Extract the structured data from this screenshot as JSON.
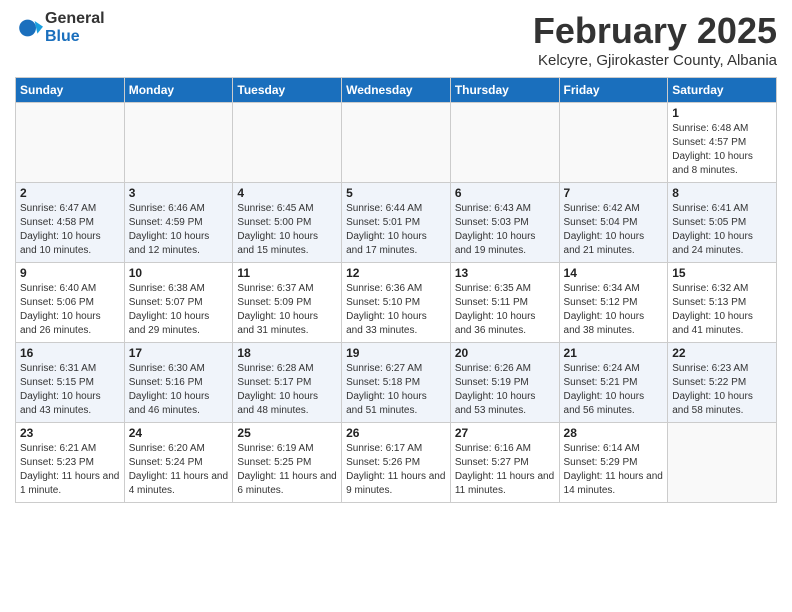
{
  "logo": {
    "general": "General",
    "blue": "Blue"
  },
  "title": "February 2025",
  "subtitle": "Kelcyre, Gjirokaster County, Albania",
  "days_header": [
    "Sunday",
    "Monday",
    "Tuesday",
    "Wednesday",
    "Thursday",
    "Friday",
    "Saturday"
  ],
  "weeks": [
    [
      {
        "day": "",
        "info": ""
      },
      {
        "day": "",
        "info": ""
      },
      {
        "day": "",
        "info": ""
      },
      {
        "day": "",
        "info": ""
      },
      {
        "day": "",
        "info": ""
      },
      {
        "day": "",
        "info": ""
      },
      {
        "day": "1",
        "info": "Sunrise: 6:48 AM\nSunset: 4:57 PM\nDaylight: 10 hours and 8 minutes."
      }
    ],
    [
      {
        "day": "2",
        "info": "Sunrise: 6:47 AM\nSunset: 4:58 PM\nDaylight: 10 hours and 10 minutes."
      },
      {
        "day": "3",
        "info": "Sunrise: 6:46 AM\nSunset: 4:59 PM\nDaylight: 10 hours and 12 minutes."
      },
      {
        "day": "4",
        "info": "Sunrise: 6:45 AM\nSunset: 5:00 PM\nDaylight: 10 hours and 15 minutes."
      },
      {
        "day": "5",
        "info": "Sunrise: 6:44 AM\nSunset: 5:01 PM\nDaylight: 10 hours and 17 minutes."
      },
      {
        "day": "6",
        "info": "Sunrise: 6:43 AM\nSunset: 5:03 PM\nDaylight: 10 hours and 19 minutes."
      },
      {
        "day": "7",
        "info": "Sunrise: 6:42 AM\nSunset: 5:04 PM\nDaylight: 10 hours and 21 minutes."
      },
      {
        "day": "8",
        "info": "Sunrise: 6:41 AM\nSunset: 5:05 PM\nDaylight: 10 hours and 24 minutes."
      }
    ],
    [
      {
        "day": "9",
        "info": "Sunrise: 6:40 AM\nSunset: 5:06 PM\nDaylight: 10 hours and 26 minutes."
      },
      {
        "day": "10",
        "info": "Sunrise: 6:38 AM\nSunset: 5:07 PM\nDaylight: 10 hours and 29 minutes."
      },
      {
        "day": "11",
        "info": "Sunrise: 6:37 AM\nSunset: 5:09 PM\nDaylight: 10 hours and 31 minutes."
      },
      {
        "day": "12",
        "info": "Sunrise: 6:36 AM\nSunset: 5:10 PM\nDaylight: 10 hours and 33 minutes."
      },
      {
        "day": "13",
        "info": "Sunrise: 6:35 AM\nSunset: 5:11 PM\nDaylight: 10 hours and 36 minutes."
      },
      {
        "day": "14",
        "info": "Sunrise: 6:34 AM\nSunset: 5:12 PM\nDaylight: 10 hours and 38 minutes."
      },
      {
        "day": "15",
        "info": "Sunrise: 6:32 AM\nSunset: 5:13 PM\nDaylight: 10 hours and 41 minutes."
      }
    ],
    [
      {
        "day": "16",
        "info": "Sunrise: 6:31 AM\nSunset: 5:15 PM\nDaylight: 10 hours and 43 minutes."
      },
      {
        "day": "17",
        "info": "Sunrise: 6:30 AM\nSunset: 5:16 PM\nDaylight: 10 hours and 46 minutes."
      },
      {
        "day": "18",
        "info": "Sunrise: 6:28 AM\nSunset: 5:17 PM\nDaylight: 10 hours and 48 minutes."
      },
      {
        "day": "19",
        "info": "Sunrise: 6:27 AM\nSunset: 5:18 PM\nDaylight: 10 hours and 51 minutes."
      },
      {
        "day": "20",
        "info": "Sunrise: 6:26 AM\nSunset: 5:19 PM\nDaylight: 10 hours and 53 minutes."
      },
      {
        "day": "21",
        "info": "Sunrise: 6:24 AM\nSunset: 5:21 PM\nDaylight: 10 hours and 56 minutes."
      },
      {
        "day": "22",
        "info": "Sunrise: 6:23 AM\nSunset: 5:22 PM\nDaylight: 10 hours and 58 minutes."
      }
    ],
    [
      {
        "day": "23",
        "info": "Sunrise: 6:21 AM\nSunset: 5:23 PM\nDaylight: 11 hours and 1 minute."
      },
      {
        "day": "24",
        "info": "Sunrise: 6:20 AM\nSunset: 5:24 PM\nDaylight: 11 hours and 4 minutes."
      },
      {
        "day": "25",
        "info": "Sunrise: 6:19 AM\nSunset: 5:25 PM\nDaylight: 11 hours and 6 minutes."
      },
      {
        "day": "26",
        "info": "Sunrise: 6:17 AM\nSunset: 5:26 PM\nDaylight: 11 hours and 9 minutes."
      },
      {
        "day": "27",
        "info": "Sunrise: 6:16 AM\nSunset: 5:27 PM\nDaylight: 11 hours and 11 minutes."
      },
      {
        "day": "28",
        "info": "Sunrise: 6:14 AM\nSunset: 5:29 PM\nDaylight: 11 hours and 14 minutes."
      },
      {
        "day": "",
        "info": ""
      }
    ]
  ]
}
